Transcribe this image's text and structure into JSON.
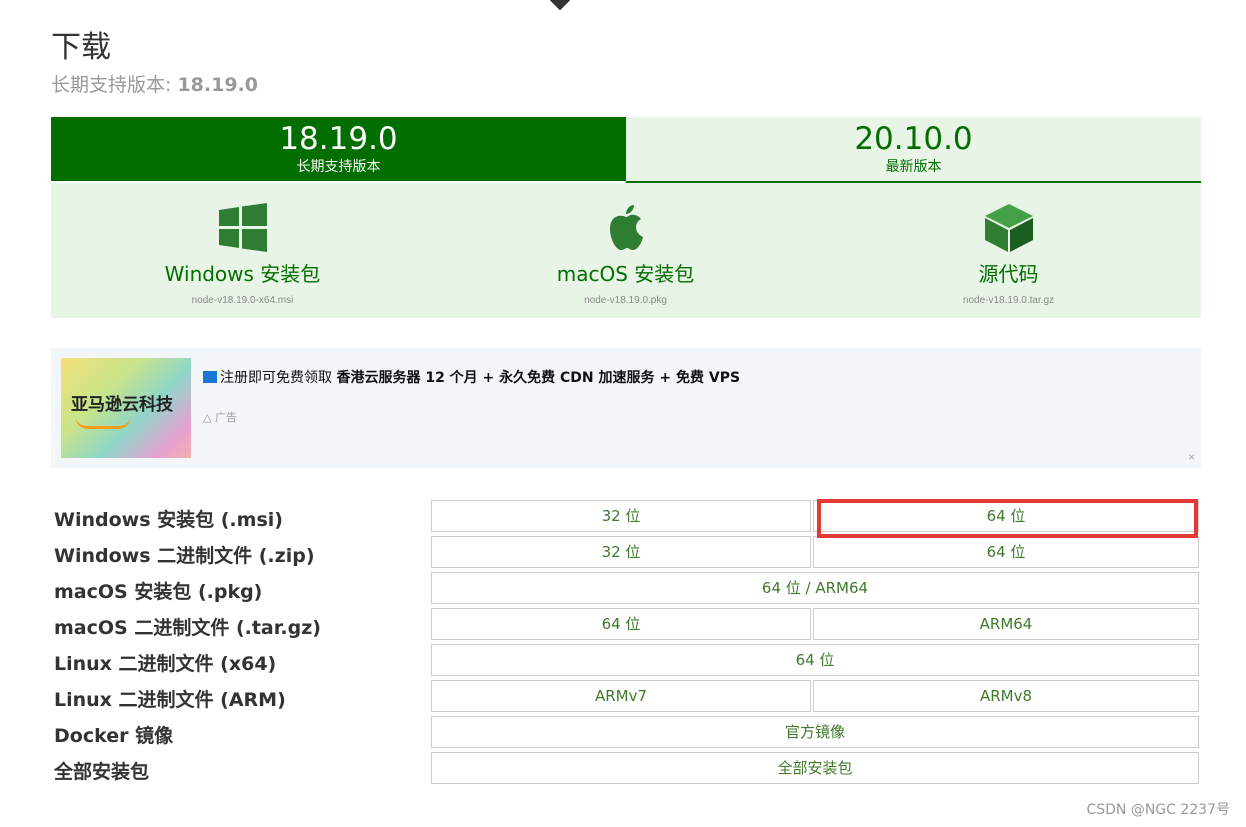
{
  "page": {
    "title": "下载",
    "lts_prefix": "长期支持版本: ",
    "lts_version": "18.19.0"
  },
  "tabs": [
    {
      "version": "18.19.0",
      "label": "长期支持版本"
    },
    {
      "version": "20.10.0",
      "label": "最新版本"
    }
  ],
  "installers": [
    {
      "label": "Windows 安装包",
      "file": "node-v18.19.0-x64.msi",
      "icon": "windows-icon"
    },
    {
      "label": "macOS 安装包",
      "file": "node-v18.19.0.pkg",
      "icon": "apple-icon"
    },
    {
      "label": "源代码",
      "file": "node-v18.19.0.tar.gz",
      "icon": "cube-icon"
    }
  ],
  "ad": {
    "brand": "亚马逊云科技",
    "text_plain": "注册即可免费领取 ",
    "text_bold": "香港云服务器 12 个月 + 永久免费 CDN 加速服务 + 免费 VPS",
    "tag": "广告",
    "close": "×"
  },
  "table": [
    {
      "label": "Windows 安装包 (.msi)",
      "cells": [
        "32 位",
        "64 位"
      ]
    },
    {
      "label": "Windows 二进制文件 (.zip)",
      "cells": [
        "32 位",
        "64 位"
      ]
    },
    {
      "label": "macOS 安装包 (.pkg)",
      "cells": [
        "64 位 / ARM64"
      ]
    },
    {
      "label": "macOS 二进制文件 (.tar.gz)",
      "cells": [
        "64 位",
        "ARM64"
      ]
    },
    {
      "label": "Linux 二进制文件 (x64)",
      "cells": [
        "64 位"
      ]
    },
    {
      "label": "Linux 二进制文件 (ARM)",
      "cells": [
        "ARMv7",
        "ARMv8"
      ]
    },
    {
      "label": "Docker 镜像",
      "cells": [
        "官方镜像"
      ]
    },
    {
      "label": "全部安装包",
      "cells": [
        "全部安装包"
      ]
    }
  ],
  "watermark": "CSDN @NGC 2237号",
  "colors": {
    "brand_green": "#026e00",
    "panel_green": "#e8f5e6",
    "highlight_red": "#e53935"
  }
}
